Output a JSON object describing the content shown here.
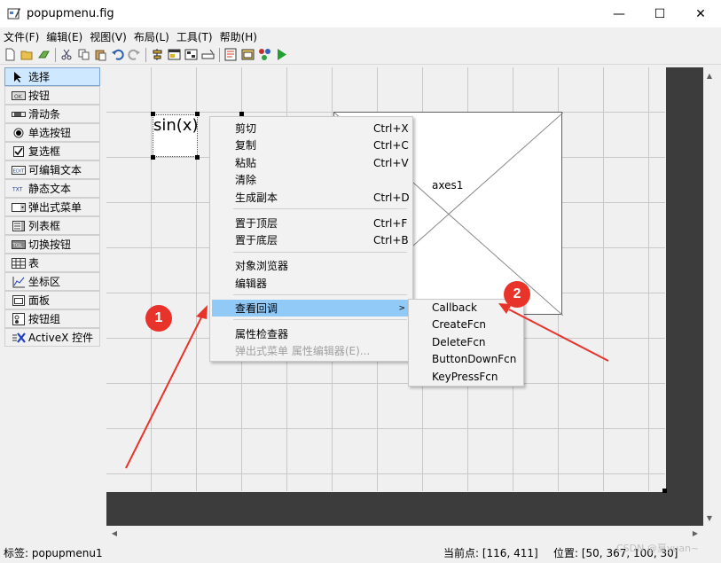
{
  "window": {
    "title": "popupmenu.fig",
    "minimize": "—",
    "maximize": "☐",
    "close": "✕"
  },
  "menubar": {
    "items": [
      "文件(F)",
      "编辑(E)",
      "视图(V)",
      "布局(L)",
      "工具(T)",
      "帮助(H)"
    ]
  },
  "toolbar": {
    "icons": [
      "new-file-icon",
      "open-folder-icon",
      "save-icon",
      "cut-icon",
      "copy-icon",
      "paste-icon",
      "undo-icon",
      "redo-icon",
      "align-icon",
      "menu-editor-icon",
      "tab-order-icon",
      "toolbar-editor-icon",
      "mfile-editor-icon",
      "property-inspector-icon",
      "object-browser-icon",
      "run-icon"
    ]
  },
  "palette": {
    "items": [
      {
        "label": "选择",
        "icon": "pointer-icon",
        "selected": true
      },
      {
        "label": "按钮",
        "icon": "push-button-icon"
      },
      {
        "label": "滑动条",
        "icon": "slider-icon"
      },
      {
        "label": "单选按钮",
        "icon": "radio-button-icon"
      },
      {
        "label": "复选框",
        "icon": "checkbox-icon"
      },
      {
        "label": "可编辑文本",
        "icon": "edit-text-icon"
      },
      {
        "label": "静态文本",
        "icon": "static-text-icon"
      },
      {
        "label": "弹出式菜单",
        "icon": "popup-menu-icon"
      },
      {
        "label": "列表框",
        "icon": "listbox-icon"
      },
      {
        "label": "切换按钮",
        "icon": "toggle-button-icon"
      },
      {
        "label": "表",
        "icon": "table-icon"
      },
      {
        "label": "坐标区",
        "icon": "axes-icon"
      },
      {
        "label": "面板",
        "icon": "panel-icon"
      },
      {
        "label": "按钮组",
        "icon": "button-group-icon"
      },
      {
        "label": "ActiveX 控件",
        "icon": "activex-icon"
      }
    ]
  },
  "canvas": {
    "text_widget": "sin(x)",
    "axes_label": "axes1"
  },
  "context_menu": {
    "items": [
      {
        "label": "剪切",
        "shortcut": "Ctrl+X"
      },
      {
        "label": "复制",
        "shortcut": "Ctrl+C"
      },
      {
        "label": "粘贴",
        "shortcut": "Ctrl+V"
      },
      {
        "label": "清除",
        "shortcut": ""
      },
      {
        "label": "生成副本",
        "shortcut": "Ctrl+D"
      },
      {
        "label": "置于顶层",
        "shortcut": "Ctrl+F"
      },
      {
        "label": "置于底层",
        "shortcut": "Ctrl+B"
      },
      {
        "label": "对象浏览器",
        "shortcut": ""
      },
      {
        "label": "编辑器",
        "shortcut": ""
      },
      {
        "label": "查看回调",
        "shortcut": "",
        "highlighted": true,
        "submenu": true
      },
      {
        "label": "属性检查器",
        "shortcut": ""
      },
      {
        "label": "弹出式菜单 属性编辑器(E)...",
        "shortcut": "",
        "disabled": true
      }
    ]
  },
  "submenu": {
    "items": [
      "Callback",
      "CreateFcn",
      "DeleteFcn",
      "ButtonDownFcn",
      "KeyPressFcn"
    ]
  },
  "annotations": {
    "badge1": "1",
    "badge2": "2",
    "color": "#e8332a"
  },
  "statusbar": {
    "tag": "标签: popupmenu1",
    "current_point": "当前点:  [116, 411]",
    "position": "位置: [50, 367, 100, 30]"
  },
  "watermark": "CSDN @夏yuan~"
}
